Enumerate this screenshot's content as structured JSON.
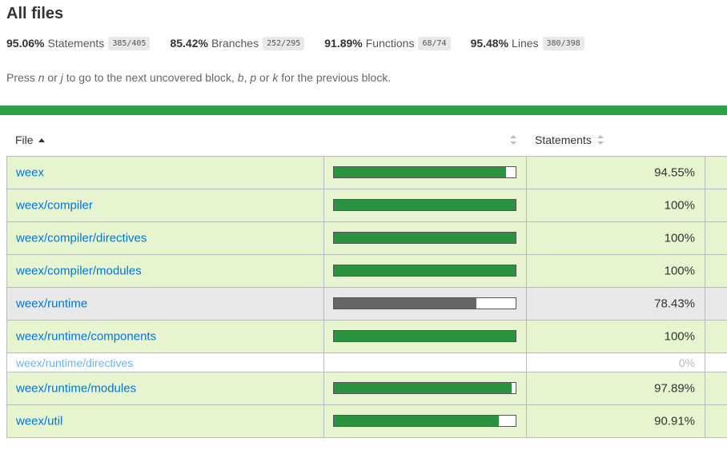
{
  "title": "All files",
  "summary": [
    {
      "pct": "95.06%",
      "label": "Statements",
      "fraction": "385/405"
    },
    {
      "pct": "85.42%",
      "label": "Branches",
      "fraction": "252/295"
    },
    {
      "pct": "91.89%",
      "label": "Functions",
      "fraction": "68/74"
    },
    {
      "pct": "95.48%",
      "label": "Lines",
      "fraction": "380/398"
    }
  ],
  "help": {
    "p1": "Press ",
    "k1": "n",
    "p2": " or ",
    "k2": "j",
    "p3": " to go to the next uncovered block, ",
    "k3": "b",
    "p4": ", ",
    "k4": "p",
    "p5": " or ",
    "k5": "k",
    "p6": " for the previous block."
  },
  "table": {
    "headers": {
      "file": "File",
      "statements": "Statements"
    },
    "rows": [
      {
        "file": "weex",
        "pct": "94.55%",
        "coverage": 94.55,
        "level": "high"
      },
      {
        "file": "weex/compiler",
        "pct": "100%",
        "coverage": 100,
        "level": "high"
      },
      {
        "file": "weex/compiler/directives",
        "pct": "100%",
        "coverage": 100,
        "level": "high"
      },
      {
        "file": "weex/compiler/modules",
        "pct": "100%",
        "coverage": 100,
        "level": "high"
      },
      {
        "file": "weex/runtime",
        "pct": "78.43%",
        "coverage": 78.43,
        "level": "medium"
      },
      {
        "file": "weex/runtime/components",
        "pct": "100%",
        "coverage": 100,
        "level": "high"
      },
      {
        "file": "weex/runtime/directives",
        "pct": "0%",
        "coverage": 0,
        "level": "empty"
      },
      {
        "file": "weex/runtime/modules",
        "pct": "97.89%",
        "coverage": 97.89,
        "level": "high"
      },
      {
        "file": "weex/util",
        "pct": "90.91%",
        "coverage": 90.91,
        "level": "high"
      }
    ]
  },
  "colors": {
    "status_bar": "#2ea147",
    "bar_high": "#2a9240",
    "bar_medium": "#666666",
    "row_high": "#e6f5d0",
    "row_medium": "#e8e8e8",
    "link": "#0074d9"
  }
}
